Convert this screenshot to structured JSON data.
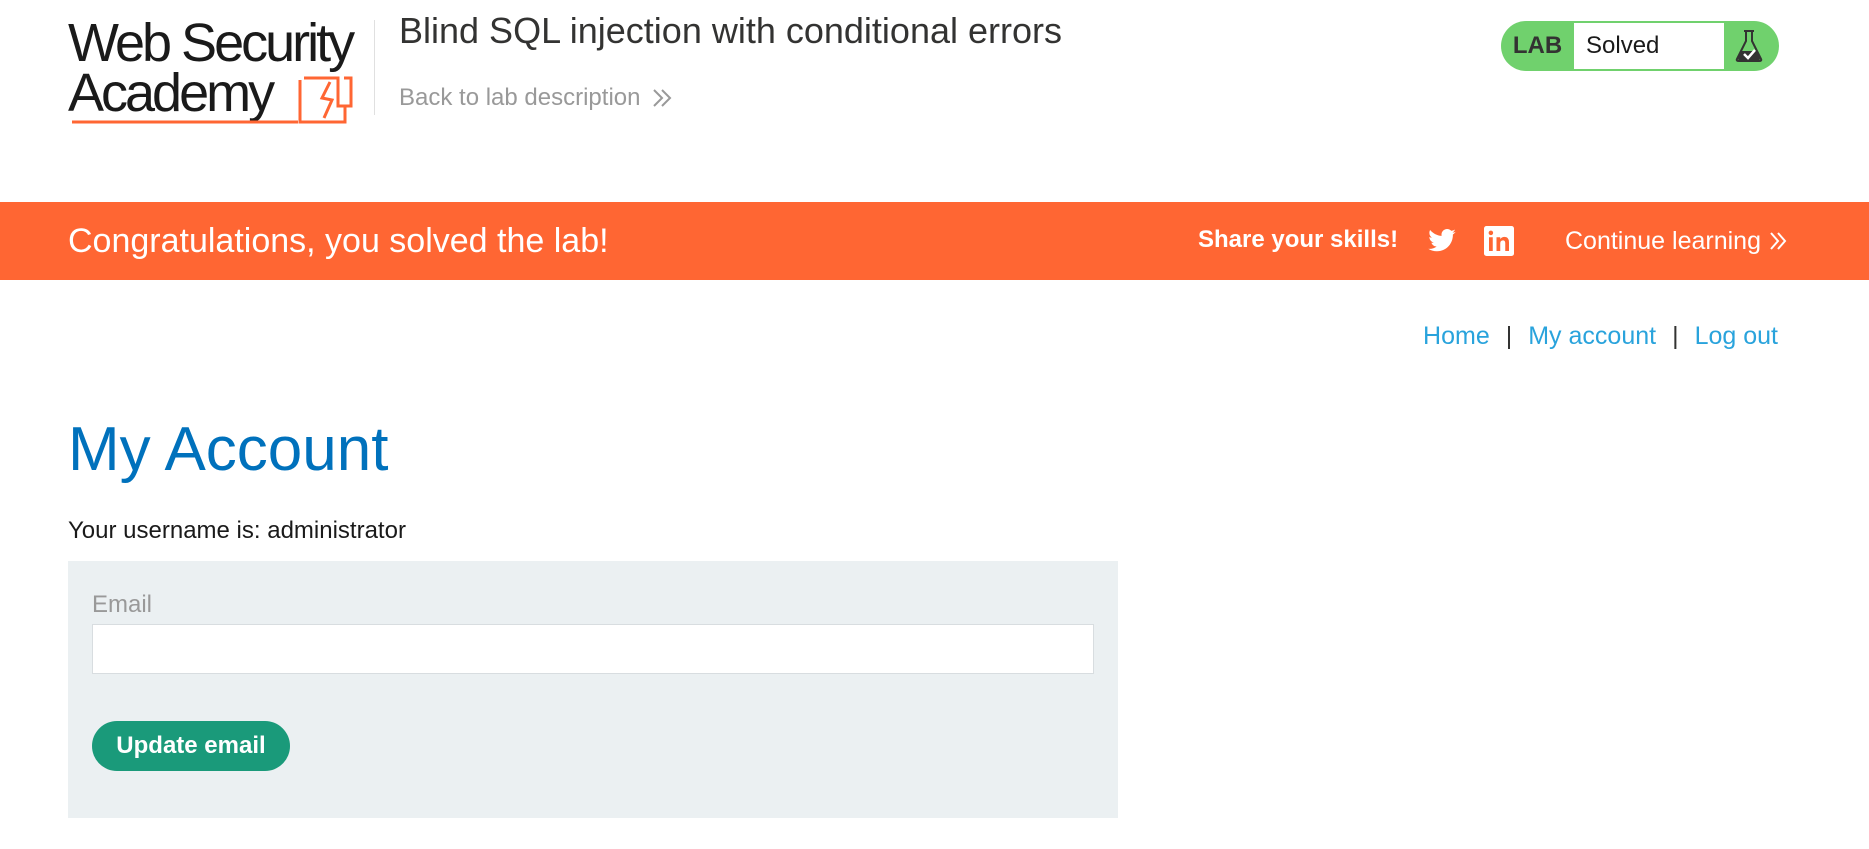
{
  "header": {
    "logo": {
      "line1": "Web Security",
      "line2": "Academy"
    },
    "lab_title": "Blind SQL injection with conditional errors",
    "back_link": "Back to lab description",
    "status": {
      "label": "LAB",
      "value": "Solved",
      "icon": "flask-check-icon"
    }
  },
  "banner": {
    "message": "Congratulations, you solved the lab!",
    "share_label": "Share your skills!",
    "share_icons": [
      "twitter-icon",
      "linkedin-icon"
    ],
    "continue_label": "Continue learning",
    "color": "#ff6633"
  },
  "nav": {
    "links": [
      "Home",
      "My account",
      "Log out"
    ],
    "separator": "|"
  },
  "main": {
    "title": "My Account",
    "username_prefix": "Your username is: ",
    "username": "administrator",
    "form": {
      "email_label": "Email",
      "email_value": "",
      "email_placeholder": "",
      "submit_label": "Update email"
    }
  },
  "colors": {
    "brand_orange": "#ff6633",
    "status_green": "#70d16d",
    "title_blue": "#0071bc",
    "link_blue": "#29a3dc",
    "button_green": "#1a9a7a",
    "form_bg": "#ebf0f2"
  }
}
